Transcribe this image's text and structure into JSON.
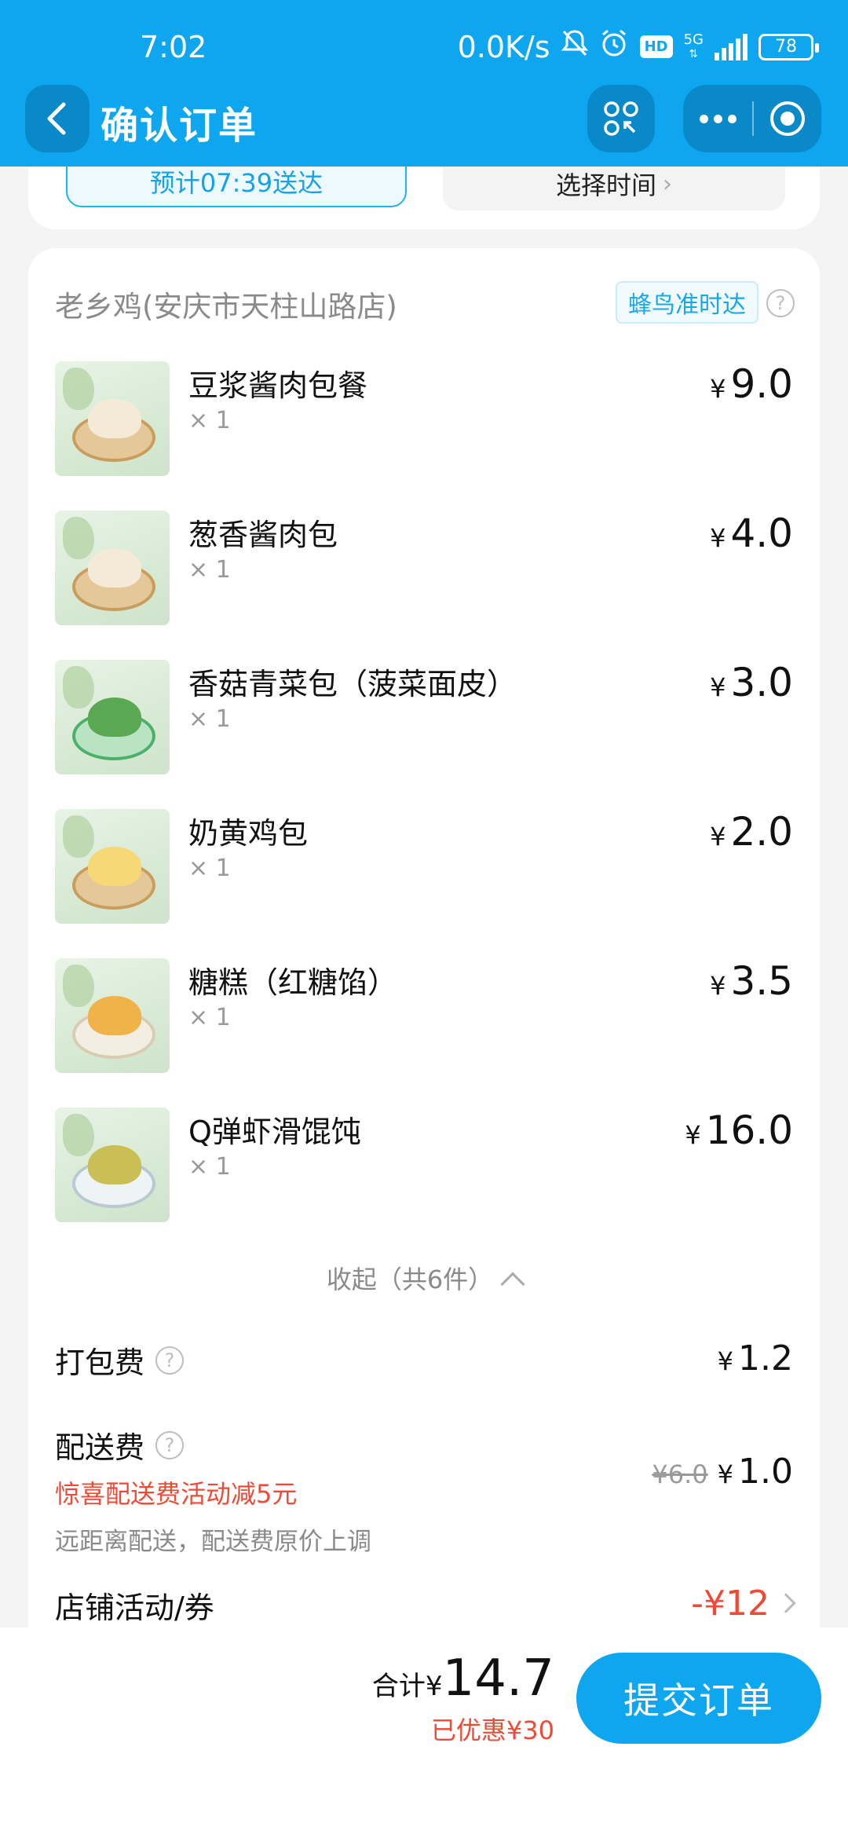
{
  "status_bar": {
    "time": "7:02",
    "network_speed": "0.0K/s",
    "hd_label": "HD",
    "signal_label": "5G",
    "battery": "78"
  },
  "nav": {
    "title": "确认订单",
    "back_icon": "chevron-left-icon",
    "scan_icon": "scan-order-icon",
    "more_icon": "more-dots-icon",
    "close_icon": "target-circle-icon"
  },
  "delivery_time": {
    "eta_label": "预计07:39送达",
    "choose_label": "选择时间"
  },
  "store": {
    "name": "老乡鸡(安庆市天柱山路店)",
    "badge": "蜂鸟准时达"
  },
  "items": [
    {
      "name": "豆浆酱肉包餐",
      "qty": "× 1",
      "currency": "¥",
      "price": "9.0"
    },
    {
      "name": "葱香酱肉包",
      "qty": "× 1",
      "currency": "¥",
      "price": "4.0"
    },
    {
      "name": "香菇青菜包（菠菜面皮）",
      "qty": "× 1",
      "currency": "¥",
      "price": "3.0"
    },
    {
      "name": "奶黄鸡包",
      "qty": "× 1",
      "currency": "¥",
      "price": "2.0"
    },
    {
      "name": "糖糕（红糖馅）",
      "qty": "× 1",
      "currency": "¥",
      "price": "3.5"
    },
    {
      "name": "Q弹虾滑馄饨",
      "qty": "× 1",
      "currency": "¥",
      "price": "16.0"
    }
  ],
  "collapse_label": "收起（共6件）",
  "fees": {
    "packaging": {
      "label": "打包费",
      "currency": "¥",
      "value": "1.2"
    },
    "delivery": {
      "label": "配送费",
      "promo_note": "惊喜配送费活动减5元",
      "distance_note": "远距离配送，配送费原价上调",
      "original": "¥6.0",
      "currency": "¥",
      "value": "1.0"
    },
    "store_promo": {
      "label": "店铺活动/券",
      "value": "-¥12"
    }
  },
  "checkout": {
    "total_prefix": "合计¥",
    "total": "14.7",
    "saved": "已优惠¥30",
    "submit_label": "提交订单"
  },
  "colors": {
    "brand_blue": "#0ea7ef",
    "promo_red": "#ef4a37"
  }
}
